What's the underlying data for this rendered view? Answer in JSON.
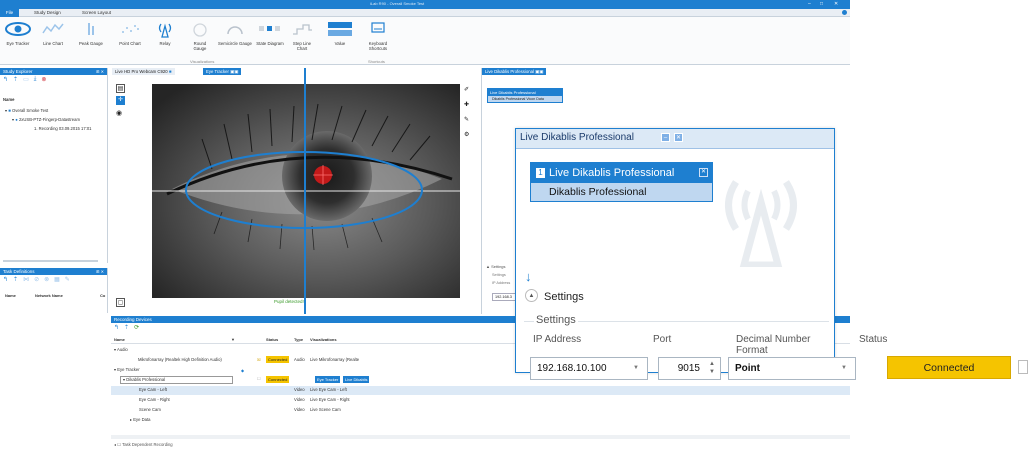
{
  "window": {
    "title": "iLab R90 - Overall Smoke Test",
    "min": "–",
    "max": "□",
    "close": "✕"
  },
  "menu": {
    "file": "File",
    "items": [
      "Study Design",
      "Screen Layout"
    ]
  },
  "ribbon": {
    "buttons": [
      "Eye Tracker",
      "Line Chart",
      "Peak Gauge",
      "Point Chart",
      "Relay",
      "Round Gauge",
      "Semicircle Gauge",
      "State Diagram",
      "Step Line Chart",
      "Value",
      "Keyboard Shortcuts"
    ],
    "groups": {
      "visualizations": "Visualizations",
      "shortcuts": "Shortcuts"
    }
  },
  "study_explorer": {
    "title": "Study Explorer",
    "name_header": "Name",
    "tree": [
      "Overall Smoke Test",
      "2xUSB-PTZ-Fingerp-Datastream",
      "1. Recording 03.09.2015 17:01"
    ]
  },
  "task_definitions": {
    "title": "Task Definitions",
    "columns": [
      "Name",
      "Network Name",
      "Co"
    ]
  },
  "video": {
    "tab_webcam": "Live HD Pro Webcam C920",
    "tab_eye": "Eye Tracker",
    "status": "Pupil detected!"
  },
  "dikablis_panel": {
    "tab": "Live Dikablis Professional",
    "card_title": "Live Dikablis Professional",
    "card_sub": "Dikablis Professional Vicon Data",
    "settings": "Settings",
    "ip_label": "IP Address",
    "ip_value": "192.168.3"
  },
  "recording": {
    "title": "Recording Devices",
    "columns": [
      "Name",
      "Status",
      "Type",
      "Visualizations"
    ],
    "rows": {
      "audio": "Audio",
      "mic": "Mikrofonarray (Realtek High Definition Audio)",
      "mic_status": "Connected",
      "mic_type": "Audio",
      "mic_vis": "Live Mikrofonarray (Realte",
      "eye_tracker": "Eye Tracker",
      "dikablis": "Dikablis Professional",
      "dikablis_status": "Connected",
      "dikablis_vis1": "Eye Tracker",
      "dikablis_vis2": "Live Dikablis",
      "eye_left": "Eye Cam - Left",
      "eye_left_type": "Video",
      "eye_left_vis": "Live Eye Cam - Left",
      "eye_right": "Eye Cam - Right",
      "eye_right_type": "Video",
      "eye_right_vis": "Live Eye Cam - Right",
      "scene": "Scene Cam",
      "scene_type": "Video",
      "scene_vis": "Live Scene Cam",
      "eye_data": "Eye Data"
    },
    "footer": "Task Dependent Recording"
  },
  "zoom": {
    "title": "Live Dikablis Professional",
    "card_num": "1",
    "card_title": "Live Dikablis Professional",
    "card_sub": "Dikablis Professional",
    "settings_toggle": "Settings",
    "settings_group": "Settings",
    "labels": {
      "ip": "IP Address",
      "port": "Port",
      "format": "Decimal Number Format",
      "status": "Status"
    },
    "ip": "192.168.10.100",
    "port": "9015",
    "format": "Point",
    "status": "Connected",
    "status_color": "#f5c400",
    "s_label": "S"
  },
  "colors": {
    "accent": "#1e7fd0",
    "connected": "#f5c400"
  }
}
